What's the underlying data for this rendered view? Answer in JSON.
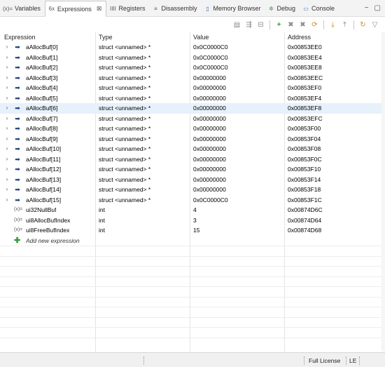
{
  "tabs": [
    {
      "label": "Variables",
      "icon": "variables-icon",
      "glyph": "(x)=",
      "active": false
    },
    {
      "label": "Expressions",
      "icon": "expressions-icon",
      "glyph": "6x",
      "active": true,
      "close": "⊠"
    },
    {
      "label": "Registers",
      "icon": "registers-icon",
      "glyph": "IIII",
      "active": false
    },
    {
      "label": "Disassembly",
      "icon": "disassembly-icon",
      "glyph": "≡",
      "active": false
    },
    {
      "label": "Memory Browser",
      "icon": "memory-browser-icon",
      "glyph": "▯",
      "active": false
    },
    {
      "label": "Debug",
      "icon": "debug-icon",
      "glyph": "✲",
      "active": false
    },
    {
      "label": "Console",
      "icon": "console-icon",
      "glyph": "▭",
      "active": false
    }
  ],
  "window_controls": {
    "minimize": "−",
    "maximize": "▢"
  },
  "columns": {
    "expression": "Expression",
    "type": "Type",
    "value": "Value",
    "address": "Address"
  },
  "rows": [
    {
      "expression": "aAllocBuf[0]",
      "type": "struct <unnamed> *",
      "value": "0x0C0000C0",
      "address": "0x00853EE0",
      "kind": "pointer"
    },
    {
      "expression": "aAllocBuf[1]",
      "type": "struct <unnamed> *",
      "value": "0x0C0000C0",
      "address": "0x00853EE4",
      "kind": "pointer"
    },
    {
      "expression": "aAllocBuf[2]",
      "type": "struct <unnamed> *",
      "value": "0x0C0000C0",
      "address": "0x00853EE8",
      "kind": "pointer"
    },
    {
      "expression": "aAllocBuf[3]",
      "type": "struct <unnamed> *",
      "value": "0x00000000",
      "address": "0x00853EEC",
      "kind": "pointer"
    },
    {
      "expression": "aAllocBuf[4]",
      "type": "struct <unnamed> *",
      "value": "0x00000000",
      "address": "0x00853EF0",
      "kind": "pointer"
    },
    {
      "expression": "aAllocBuf[5]",
      "type": "struct <unnamed> *",
      "value": "0x00000000",
      "address": "0x00853EF4",
      "kind": "pointer"
    },
    {
      "expression": "aAllocBuf[6]",
      "type": "struct <unnamed> *",
      "value": "0x00000000",
      "address": "0x00853EF8",
      "kind": "pointer",
      "selected": true
    },
    {
      "expression": "aAllocBuf[7]",
      "type": "struct <unnamed> *",
      "value": "0x00000000",
      "address": "0x00853EFC",
      "kind": "pointer"
    },
    {
      "expression": "aAllocBuf[8]",
      "type": "struct <unnamed> *",
      "value": "0x00000000",
      "address": "0x00853F00",
      "kind": "pointer"
    },
    {
      "expression": "aAllocBuf[9]",
      "type": "struct <unnamed> *",
      "value": "0x00000000",
      "address": "0x00853F04",
      "kind": "pointer"
    },
    {
      "expression": "aAllocBuf[10]",
      "type": "struct <unnamed> *",
      "value": "0x00000000",
      "address": "0x00853F08",
      "kind": "pointer"
    },
    {
      "expression": "aAllocBuf[11]",
      "type": "struct <unnamed> *",
      "value": "0x00000000",
      "address": "0x00853F0C",
      "kind": "pointer"
    },
    {
      "expression": "aAllocBuf[12]",
      "type": "struct <unnamed> *",
      "value": "0x00000000",
      "address": "0x00853F10",
      "kind": "pointer"
    },
    {
      "expression": "aAllocBuf[13]",
      "type": "struct <unnamed> *",
      "value": "0x00000000",
      "address": "0x00853F14",
      "kind": "pointer"
    },
    {
      "expression": "aAllocBuf[14]",
      "type": "struct <unnamed> *",
      "value": "0x00000000",
      "address": "0x00853F18",
      "kind": "pointer"
    },
    {
      "expression": "aAllocBuf[15]",
      "type": "struct <unnamed> *",
      "value": "0x0C0000C0",
      "address": "0x00853F1C",
      "kind": "pointer"
    },
    {
      "expression": "ui32NullBuf",
      "type": "int",
      "value": "4",
      "address": "0x00874D6C",
      "kind": "variable"
    },
    {
      "expression": "ui8AllocBufIndex",
      "type": "int",
      "value": "3",
      "address": "0x00874D64",
      "kind": "variable"
    },
    {
      "expression": "ui8FreeBufIndex",
      "type": "int",
      "value": "15",
      "address": "0x00874D68",
      "kind": "variable"
    }
  ],
  "add_expression_label": "Add new expression",
  "status": {
    "license": "Full License",
    "endian": "LE"
  },
  "colors": {
    "selection": "#e6f1fc",
    "pointer_arrow": "#1f3f7a",
    "add_icon": "#3a9a3a"
  }
}
